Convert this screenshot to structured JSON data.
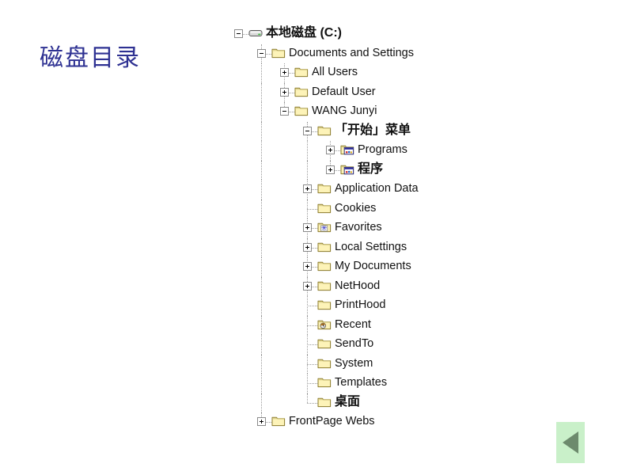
{
  "slide": {
    "title": "磁盘目录",
    "title_color": "#2e3192",
    "background": "#ffffff"
  },
  "nav": {
    "back_button_label": "",
    "back_icon": "triangle-left-icon",
    "background": "#c9f0c9",
    "triangle_color": "#6d8a6d"
  },
  "tree": {
    "nodes": [
      {
        "label": "本地磁盘 (C:)",
        "level": 0,
        "toggle": "minus",
        "icon": "hard-disk-icon",
        "cjk": true
      },
      {
        "label": "Documents and Settings",
        "level": 1,
        "toggle": "minus",
        "icon": "folder-icon",
        "cjk": false
      },
      {
        "label": "All Users",
        "level": 2,
        "toggle": "plus",
        "icon": "folder-icon",
        "cjk": false
      },
      {
        "label": "Default User",
        "level": 2,
        "toggle": "plus",
        "icon": "folder-icon",
        "cjk": false
      },
      {
        "label": "WANG Junyi",
        "level": 2,
        "toggle": "minus",
        "icon": "folder-icon",
        "cjk": false
      },
      {
        "label": "「开始」菜单",
        "level": 3,
        "toggle": "minus",
        "icon": "folder-icon",
        "cjk": true
      },
      {
        "label": "Programs",
        "level": 4,
        "toggle": "plus",
        "icon": "folder-programs-icon",
        "cjk": false
      },
      {
        "label": "程序",
        "level": 4,
        "toggle": "plus",
        "icon": "folder-programs-icon",
        "cjk": true
      },
      {
        "label": "Application Data",
        "level": 3,
        "toggle": "plus",
        "icon": "folder-icon",
        "cjk": false
      },
      {
        "label": "Cookies",
        "level": 3,
        "toggle": "none",
        "icon": "folder-icon",
        "cjk": false
      },
      {
        "label": "Favorites",
        "level": 3,
        "toggle": "plus",
        "icon": "folder-favorites-icon",
        "cjk": false
      },
      {
        "label": "Local Settings",
        "level": 3,
        "toggle": "plus",
        "icon": "folder-icon",
        "cjk": false
      },
      {
        "label": "My Documents",
        "level": 3,
        "toggle": "plus",
        "icon": "folder-icon",
        "cjk": false
      },
      {
        "label": "NetHood",
        "level": 3,
        "toggle": "plus",
        "icon": "folder-icon",
        "cjk": false
      },
      {
        "label": "PrintHood",
        "level": 3,
        "toggle": "none",
        "icon": "folder-icon",
        "cjk": false
      },
      {
        "label": "Recent",
        "level": 3,
        "toggle": "none",
        "icon": "folder-recent-icon",
        "cjk": false
      },
      {
        "label": "SendTo",
        "level": 3,
        "toggle": "none",
        "icon": "folder-icon",
        "cjk": false
      },
      {
        "label": "System",
        "level": 3,
        "toggle": "none",
        "icon": "folder-icon",
        "cjk": false
      },
      {
        "label": "Templates",
        "level": 3,
        "toggle": "none",
        "icon": "folder-icon",
        "cjk": false
      },
      {
        "label": "桌面",
        "level": 3,
        "toggle": "none",
        "icon": "folder-icon",
        "cjk": true
      },
      {
        "label": "FrontPage Webs",
        "level": 1,
        "toggle": "plus",
        "icon": "folder-icon",
        "cjk": false
      }
    ]
  }
}
